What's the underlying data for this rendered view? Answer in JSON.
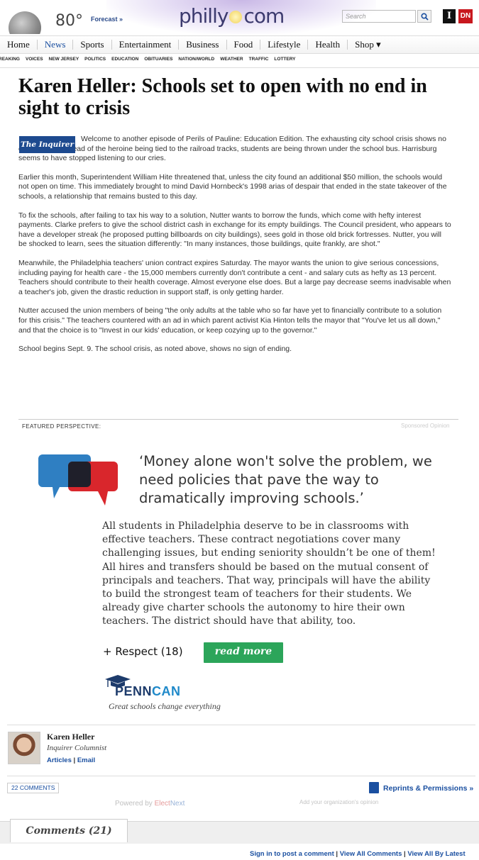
{
  "header": {
    "temperature": "80°",
    "forecast_link": "Forecast »",
    "logo_left": "philly",
    "logo_right": "com",
    "search_placeholder": "Search",
    "badge_inquirer": "I",
    "badge_dn": "DN"
  },
  "nav": {
    "items": [
      "Home",
      "News",
      "Sports",
      "Entertainment",
      "Business",
      "Food",
      "Lifestyle",
      "Health",
      "Shop ▾"
    ],
    "active": "News"
  },
  "subnav": [
    "REAKING",
    "VOICES",
    "NEW JERSEY",
    "POLITICS",
    "EDUCATION",
    "OBITUARIES",
    "NATION/WORLD",
    "WEATHER",
    "TRAFFIC",
    "LOTTERY"
  ],
  "article": {
    "title": "Karen Heller: Schools set to open with no end in sight to crisis",
    "source_logo": "The Inquirer",
    "paragraphs": [
      "Welcome to another episode of Perils of Pauline: Education Edition. The exhausting city school crisis shows no end in sight. Instead of the heroine being tied to the railroad tracks, students are being thrown under the school bus. Harrisburg seems to have stopped listening to our cries.",
      "Earlier this month, Superintendent William Hite threatened that, unless the city found an additional $50 million, the schools would not open on time. This immediately brought to mind David Hornbeck's 1998 arias of despair that ended in the state takeover of the schools, a relationship that remains busted to this day.",
      "To fix the schools, after failing to tax his way to a solution, Nutter wants to borrow the funds, which come with hefty interest payments. Clarke prefers to give the school district cash in exchange for its empty buildings. The Council president, who appears to have a developer streak (he proposed putting billboards on city buildings), sees gold in those old brick fortresses. Nutter, you will be shocked to learn, sees the situation differently: \"In many instances, those buildings, quite frankly, are shot.\"",
      "Meanwhile, the Philadelphia teachers' union contract expires Saturday. The mayor wants the union to give serious concessions, including paying for health care - the 15,000 members currently don't contribute a cent - and salary cuts as hefty as 13 percent. Teachers should contribute to their health coverage. Almost everyone else does. But a large pay decrease seems inadvisable when a teacher's job, given the drastic reduction in support staff, is only getting harder.",
      "Nutter accused the union members of being \"the only adults at the table who so far have yet to financially contribute to a solution for this crisis.\" The teachers countered with an ad in which parent activist Kia Hinton tells the mayor that \"You've let us all down,\" and that the choice is to \"Invest in our kids' education, or keep cozying up to the governor.\"",
      "School begins Sept. 9. The school crisis, as noted above, shows no sign of ending."
    ]
  },
  "featured": {
    "label": "FEATURED PERSPECTIVE:",
    "sponsored": "Sponsored Opinion",
    "quote": "‘Money alone won't solve the problem, we need policies that pave the way to dramatically improving schools.’",
    "body": "All students in Philadelphia deserve to be in classrooms with effective teachers. These contract negotiations cover many challenging issues, but ending seniority shouldn’t be one of them! All hires and transfers should be based on the mutual consent of principals and teachers. That way, principals will have the ability to build the strongest team of teachers for their students. We already give charter schools the autonomy to hire their own teachers. The district should have that ability, too.",
    "respect": "+ Respect (18)",
    "read_more": "read  more",
    "org_name_a": "PENN",
    "org_name_b": "CAN",
    "org_tagline": "Great schools change everything",
    "colors": {
      "bubble_blue": "#2f7fc2",
      "bubble_red": "#d9262c",
      "read_more_green": "#2ca55a"
    }
  },
  "author": {
    "name": "Karen Heller",
    "role": "Inquirer Columnist",
    "link_articles": "Articles",
    "link_email": "Email",
    "separator": "|"
  },
  "footer": {
    "comments_count": "22 COMMENTS",
    "reprints": "Reprints & Permissions »",
    "powered_prefix": "Powered by ",
    "powered_brand_a": "Elect",
    "powered_brand_b": "Next",
    "add_org": "Add your organization's opinion",
    "comments_tab": "Comments  (21)",
    "bottom_links": [
      "Sign in to post a comment",
      "View All Comments",
      "View All By Latest"
    ],
    "separator": "|"
  }
}
